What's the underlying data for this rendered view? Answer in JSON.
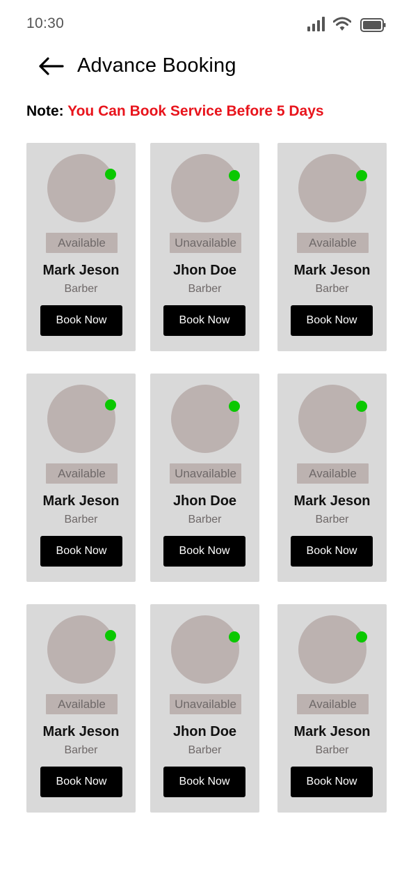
{
  "status_bar": {
    "time": "10:30",
    "icons": [
      "cellular-signal-icon",
      "wifi-icon",
      "battery-icon"
    ]
  },
  "header": {
    "back_icon": "arrow-left-icon",
    "title": "Advance Booking"
  },
  "note": {
    "label": "Note:",
    "text": "You Can Book Service Before 5 Days",
    "text_color": "#e8141c"
  },
  "colors": {
    "card_bg": "#d9d9d9",
    "avatar_bg": "#bcb2b0",
    "online_dot": "#0ac800",
    "button_bg": "#000000"
  },
  "barbers": [
    {
      "status": "Available",
      "name": "Mark Jeson",
      "role": "Barber",
      "button": "Book Now"
    },
    {
      "status": "Unavailable",
      "name": "Jhon Doe",
      "role": "Barber",
      "button": "Book Now"
    },
    {
      "status": "Available",
      "name": "Mark Jeson",
      "role": "Barber",
      "button": "Book Now"
    },
    {
      "status": "Available",
      "name": "Mark Jeson",
      "role": "Barber",
      "button": "Book Now"
    },
    {
      "status": "Unavailable",
      "name": "Jhon Doe",
      "role": "Barber",
      "button": "Book Now"
    },
    {
      "status": "Available",
      "name": "Mark Jeson",
      "role": "Barber",
      "button": "Book Now"
    },
    {
      "status": "Available",
      "name": "Mark Jeson",
      "role": "Barber",
      "button": "Book Now"
    },
    {
      "status": "Unavailable",
      "name": "Jhon Doe",
      "role": "Barber",
      "button": "Book Now"
    },
    {
      "status": "Available",
      "name": "Mark Jeson",
      "role": "Barber",
      "button": "Book Now"
    }
  ]
}
